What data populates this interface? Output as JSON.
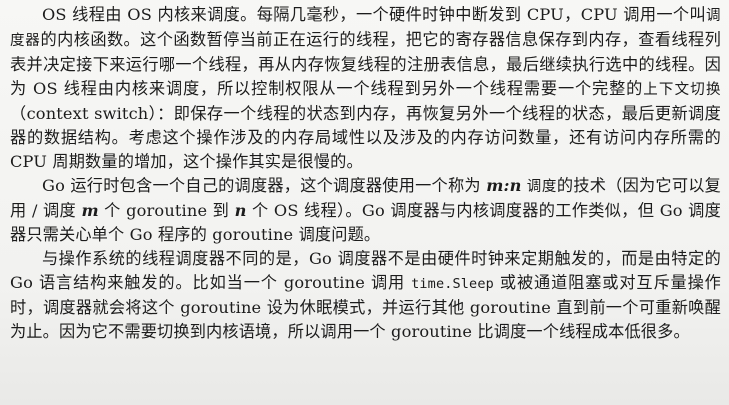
{
  "paragraphs": {
    "p1": {
      "a": "OS 线程由 OS 内核来调度。每隔几毫秒，一个硬件时钟中断发到 CPU，CPU 调用一个叫",
      "t1": "调度器",
      "b": "的内核函数。这个函数暂停当前正在运行的线程，把它的寄存器信息保存到内存，查看线程列表并决定接下来运行哪一个线程，再从内存恢复线程的注册表信息，最后继续执行选中的线程。因为 OS 线程由内核来调度，所以控制权限从一个线程到另外一个线程需要一个完整的",
      "t2": "上下文切换",
      "c": "（context switch）：即保存一个线程的状态到内存，再恢复另外一个线程的状态，最后更新调度器的数据结构。考虑这个操作涉及的内存局域性以及涉及的内存访问数量，还有访问内存所需的 CPU 周期数量的增加，这个操作其实是很慢的。"
    },
    "p2": {
      "a": "Go 运行时包含一个自己的调度器，这个调度器使用一个称为 ",
      "m": "m",
      "colon": ":",
      "n": "n",
      "t1": " 调度",
      "b": "的技术（因为它可以复用 / 调度 ",
      "m2": "m",
      "c": " 个 goroutine 到 ",
      "n2": "n",
      "d": " 个 OS 线程）。Go 调度器与内核调度器的工作类似，但 Go 调度器只需关心单个 Go 程序的 goroutine 调度问题。"
    },
    "p3": {
      "a": "与操作系统的线程调度器不同的是，Go 调度器不是由硬件时钟来定期触发的，而是由特定的 Go 语言结构来触发的。比如当一个 goroutine 调用 ",
      "code": "time.Sleep",
      "b": " 或被通道阻塞或对互斥量操作时，调度器就会将这个 goroutine 设为休眠模式，并运行其他 goroutine 直到前一个可重新唤醒为止。因为它不需要切换到内核语境，所以调用一个 goroutine 比调度一个线程成本低很多。"
    }
  }
}
